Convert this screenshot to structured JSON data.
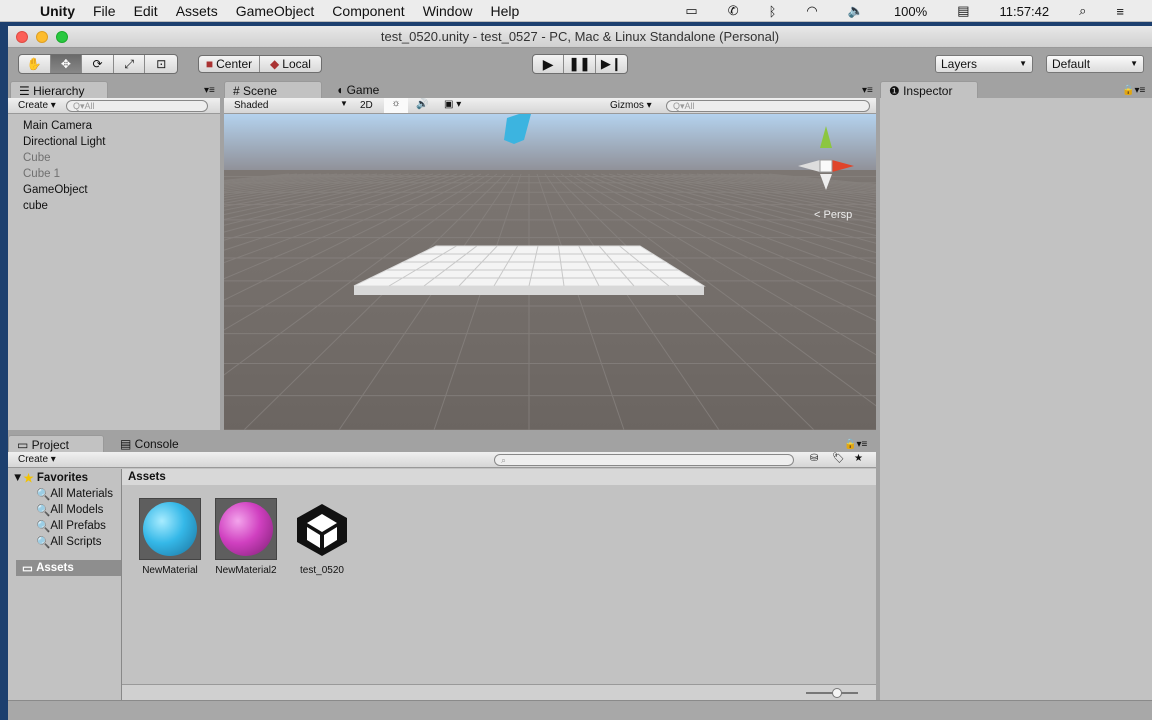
{
  "menubar": {
    "app": "Unity",
    "items": [
      "File",
      "Edit",
      "Assets",
      "GameObject",
      "Component",
      "Window",
      "Help"
    ],
    "battery": "100%",
    "time": "11:57:42"
  },
  "window": {
    "title": "test_0520.unity - test_0527 - PC, Mac & Linux Standalone (Personal)"
  },
  "toolbar": {
    "pivot": "Center",
    "space": "Local",
    "layers": "Layers",
    "layout": "Default"
  },
  "hierarchy": {
    "tab": "Hierarchy",
    "create": "Create",
    "search_placeholder": "All",
    "items": [
      {
        "label": "Main Camera",
        "dim": false
      },
      {
        "label": "Directional Light",
        "dim": false
      },
      {
        "label": "Cube",
        "dim": true
      },
      {
        "label": "Cube 1",
        "dim": true
      },
      {
        "label": "GameObject",
        "dim": false
      },
      {
        "label": "cube",
        "dim": false
      }
    ]
  },
  "scene": {
    "tab_scene": "Scene",
    "tab_game": "Game",
    "shading": "Shaded",
    "mode2d": "2D",
    "gizmos": "Gizmos",
    "search_placeholder": "All",
    "projection": "Persp"
  },
  "inspector": {
    "tab": "Inspector"
  },
  "project": {
    "tab_project": "Project",
    "tab_console": "Console",
    "create": "Create",
    "favorites": "Favorites",
    "fav_items": [
      "All Materials",
      "All Models",
      "All Prefabs",
      "All Scripts"
    ],
    "assets_root": "Assets",
    "breadcrumb": "Assets",
    "assets": [
      {
        "name": "NewMaterial",
        "color": "#35b8e8"
      },
      {
        "name": "NewMaterial2",
        "color": "#d040c0"
      },
      {
        "name": "test_0520",
        "color": ""
      }
    ]
  }
}
